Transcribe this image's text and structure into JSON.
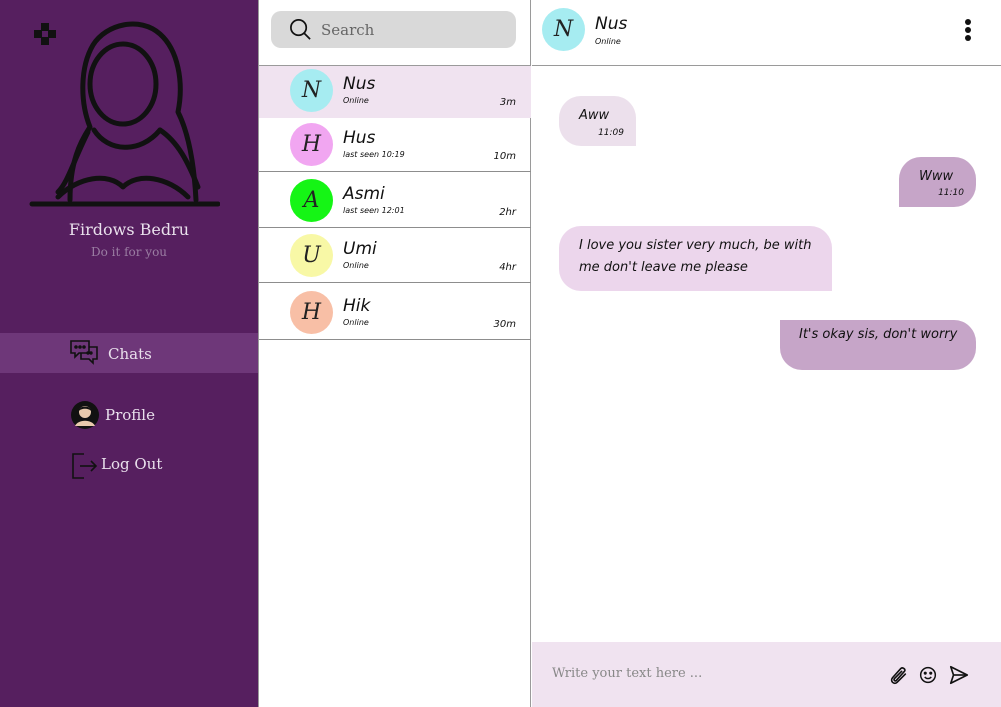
{
  "sidebar": {
    "profile_name": "Firdows Bedru",
    "profile_status": "Do it for you",
    "nav": [
      {
        "label": "Chats",
        "icon": "chat-bubbles-icon",
        "active": true
      },
      {
        "label": "Profile",
        "icon": "user-icon",
        "active": false
      },
      {
        "label": "Log Out",
        "icon": "logout-icon",
        "active": false
      }
    ]
  },
  "chatlist": {
    "search_placeholder": "Search",
    "contacts": [
      {
        "initial": "N",
        "name": "Nus",
        "status": "Online",
        "time": "3m",
        "color": "#a6ecf1",
        "active": true
      },
      {
        "initial": "H",
        "name": "Hus",
        "status": "last seen 10:19",
        "time": "10m",
        "color": "#f1a6f1",
        "active": false
      },
      {
        "initial": "A",
        "name": "Asmi",
        "status": "last seen 12:01",
        "time": "2hr",
        "color": "#15f515",
        "active": false
      },
      {
        "initial": "U",
        "name": "Umi",
        "status": "Online",
        "time": "4hr",
        "color": "#f8f8a6",
        "active": false
      },
      {
        "initial": "H",
        "name": "Hik",
        "status": "Online",
        "time": "30m",
        "color": "#f8bfa6",
        "active": false
      }
    ]
  },
  "chat": {
    "header": {
      "initial": "N",
      "name": "Nus",
      "status": "Online"
    },
    "messages": [
      {
        "text": "Aww",
        "time": "11:09",
        "direction": "incoming"
      },
      {
        "text": "Www",
        "time": "11:10",
        "direction": "outgoing"
      },
      {
        "text": "I love you sister very much, be with me don't leave me please",
        "time": "",
        "direction": "incoming"
      },
      {
        "text": "It's okay sis, don't worry",
        "time": "",
        "direction": "outgoing"
      }
    ],
    "composer_placeholder": "Write your text here ...",
    "composer_icons": [
      "paperclip-icon",
      "smiley-icon",
      "send-icon"
    ]
  },
  "colors": {
    "sidebar_bg": "#561f5f",
    "sidebar_active": "#6e3779",
    "list_active": "#f0e3f0",
    "bubble_in_light": "#ece0ec",
    "bubble_in": "#ecd6ec",
    "bubble_out": "#c6a5c8",
    "composer_bg": "#f0e3f0"
  }
}
